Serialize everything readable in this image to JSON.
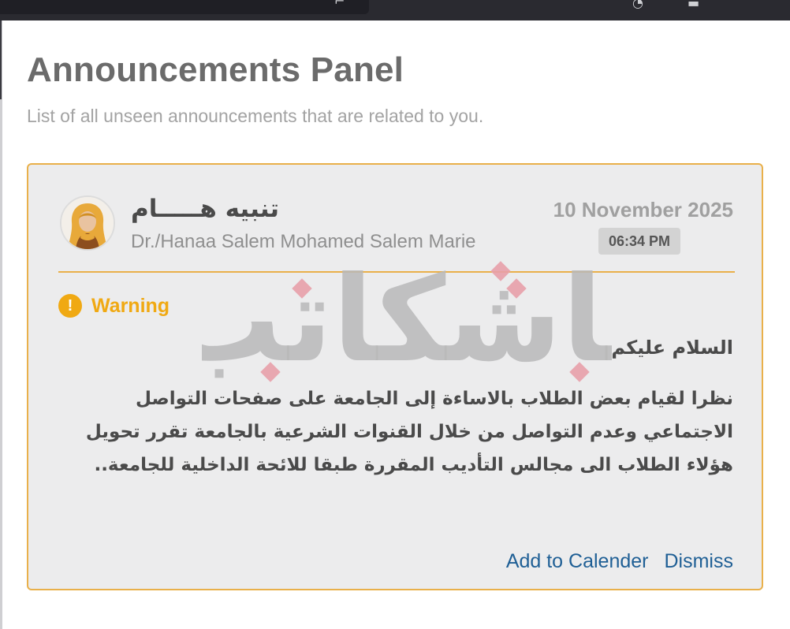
{
  "page": {
    "title": "Announcements Panel",
    "subtitle": "List of all unseen announcements that are related to you."
  },
  "announcement": {
    "title": "تنبيه هـــــام",
    "author": "Dr./Hanaa Salem Mohamed Salem Marie",
    "date": "10 November 2025",
    "time": "06:34 PM",
    "category": "Warning",
    "category_icon": "warning-icon",
    "greeting": "السلام عليكم",
    "body": "نظرا لقيام بعض الطلاب بالاساءة إلى الجامعة على صفحات التواصل الاجتماعي وعدم التواصل من خلال القنوات الشرعية بالجامعة تقرر تحويل هؤلاء الطلاب الى مجالس التأديب المقررة طبقا للائحة الداخلية للجامعة..",
    "actions": {
      "add_to_calendar": "Add to Calender",
      "dismiss": "Dismiss"
    }
  },
  "watermark": {
    "text": "باشكاتب"
  },
  "colors": {
    "accent_border": "#e9b04a",
    "warning": "#f0a913",
    "link": "#1f5f95",
    "card_bg": "#ececed",
    "watermark_gray": "#b8b8b8",
    "watermark_pink": "#e8a0a8"
  }
}
